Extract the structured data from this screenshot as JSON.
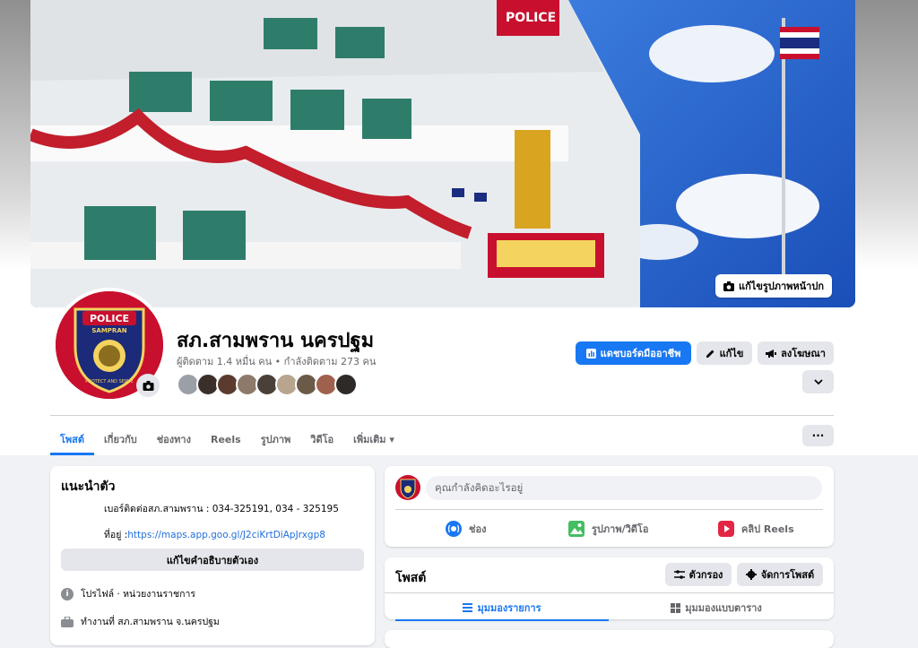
{
  "cover": {
    "edit_label": "แก้ไขรูปภาพหน้าปก",
    "building_sign_text": "POLICE"
  },
  "profile": {
    "logo_text_top": "POLICE",
    "logo_text_sub": "SAMPRAN",
    "logo_text_bottom": "PROTECT AND SERVE",
    "name": "สภ.สามพราน นครปฐม",
    "followers": "ผู้ติดตาม 1.4 หมื่น คน • กำลังติดตาม 273 คน"
  },
  "actions": {
    "dashboard_label": "แดชบอร์ดมืออาชีพ",
    "edit_label": "แก้ไข",
    "advertise_label": "ลงโฆษณา",
    "more_label": "⌄"
  },
  "tabs": [
    {
      "label": "โพสต์"
    },
    {
      "label": "เกี่ยวกับ"
    },
    {
      "label": "ช่องทาง"
    },
    {
      "label": "Reels"
    },
    {
      "label": "รูปภาพ"
    },
    {
      "label": "วิดีโอ"
    },
    {
      "label": "เพิ่มเติม ▾"
    }
  ],
  "tabs_more_label": "···",
  "intro": {
    "title": "แนะนำตัว",
    "contact_line": "เบอร์ติดต่อสภ.สามพราน : 034-325191, 034 - 325195",
    "address_prefix": "ที่อยู่ :",
    "address_link": "https://maps.app.goo.gl/J2ciKrtDiApJrxgp8",
    "edit_bio_label": "แก้ไขคำอธิบายตัวเอง",
    "profile_type": "โปรไฟล์ · หน่วยงานราชการ",
    "work": "ทำงานที่ สภ.สามพราน จ.นครปฐม"
  },
  "composer": {
    "placeholder": "คุณกำลังคิดอะไรอยู่",
    "live_label": "ช่อง",
    "photo_label": "รูปภาพ/วิดีโอ",
    "reels_label": "คลิป Reels"
  },
  "posts": {
    "title": "โพสต์",
    "filter_label": "ตัวกรอง",
    "manage_label": "จัดการโพสต์",
    "list_view_label": "มุมมองรายการ",
    "grid_view_label": "มุมมองแบบตาราง"
  },
  "colors": {
    "accent": "#1877f2",
    "background": "#f0f2f5",
    "logo_red": "#c8102e"
  }
}
